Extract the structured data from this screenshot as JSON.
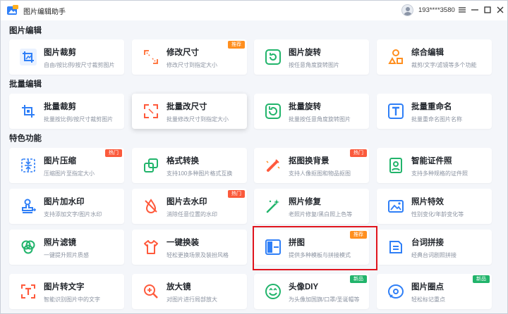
{
  "app": {
    "title": "图片编辑助手"
  },
  "user": {
    "phone": "193****3580"
  },
  "colors": {
    "accent": "#2f7ff7",
    "badge_orange": "#ff8f1f",
    "badge_red": "#fb5a3c",
    "badge_green": "#21b46b",
    "highlight": "#e0141d"
  },
  "sections": [
    {
      "title": "图片编辑"
    },
    {
      "title": "批量编辑"
    },
    {
      "title": "特色功能"
    }
  ],
  "cards": [
    {
      "title": "图片裁剪",
      "desc": "自由/按比例/按尺寸裁剪图片",
      "icon": "crop-icon"
    },
    {
      "title": "修改尺寸",
      "desc": "修改尺寸到指定大小",
      "badge": "推荐",
      "icon": "resize-icon"
    },
    {
      "title": "图片旋转",
      "desc": "按任意角度旋转图片",
      "icon": "rotate-icon"
    },
    {
      "title": "综合编辑",
      "desc": "裁剪/文字/滤镜等多个功能",
      "icon": "shapes-icon"
    },
    {
      "title": "批量裁剪",
      "desc": "批量按比例/按尺寸裁剪图片",
      "icon": "batch-crop-icon"
    },
    {
      "title": "批量改尺寸",
      "desc": "批量修改尺寸到指定大小",
      "icon": "batch-resize-icon"
    },
    {
      "title": "批量旋转",
      "desc": "批量按任意角度旋转图片",
      "icon": "batch-rotate-icon"
    },
    {
      "title": "批量重命名",
      "desc": "批量重命名图片名称",
      "icon": "rename-icon"
    },
    {
      "title": "图片压缩",
      "desc": "压缩图片至指定大小",
      "badge": "热门",
      "icon": "compress-icon"
    },
    {
      "title": "格式转换",
      "desc": "支持100多种图片格式互换",
      "icon": "convert-icon"
    },
    {
      "title": "抠图换背景",
      "desc": "支持人像抠图和物品抠图",
      "badge": "热门",
      "icon": "cutout-icon"
    },
    {
      "title": "智能证件照",
      "desc": "支持多种规格的证件照",
      "icon": "id-photo-icon"
    },
    {
      "title": "图片加水印",
      "desc": "支持添加文字/图片水印",
      "icon": "stamp-icon"
    },
    {
      "title": "图片去水印",
      "desc": "消除任意位置的水印",
      "badge": "热门",
      "icon": "remove-watermark-icon"
    },
    {
      "title": "照片修复",
      "desc": "老照片修复/黑白照上色等",
      "icon": "magic-wand-icon"
    },
    {
      "title": "照片特效",
      "desc": "性别变化/年龄变化等",
      "icon": "effects-icon"
    },
    {
      "title": "照片滤镜",
      "desc": "一键提升照片质感",
      "icon": "filter-icon"
    },
    {
      "title": "一键换装",
      "desc": "轻松更换场景及装扮风格",
      "icon": "shirt-icon"
    },
    {
      "title": "拼图",
      "desc": "提供多种模板与拼接模式",
      "badge": "推荐",
      "icon": "collage-icon"
    },
    {
      "title": "台词拼接",
      "desc": "经典台词剧照拼接",
      "icon": "lines-stitch-icon"
    },
    {
      "title": "图片转文字",
      "desc": "智能识别图片中的文字",
      "icon": "ocr-icon"
    },
    {
      "title": "放大镜",
      "desc": "对图片进行局部放大",
      "icon": "magnifier-icon"
    },
    {
      "title": "头像DIY",
      "desc": "为头像加国旗/口罩/圣诞帽等",
      "badge": "新品",
      "icon": "avatar-diy-icon"
    },
    {
      "title": "图片圈点",
      "desc": "轻松标记重点",
      "badge": "新品",
      "icon": "circle-mark-icon"
    }
  ]
}
